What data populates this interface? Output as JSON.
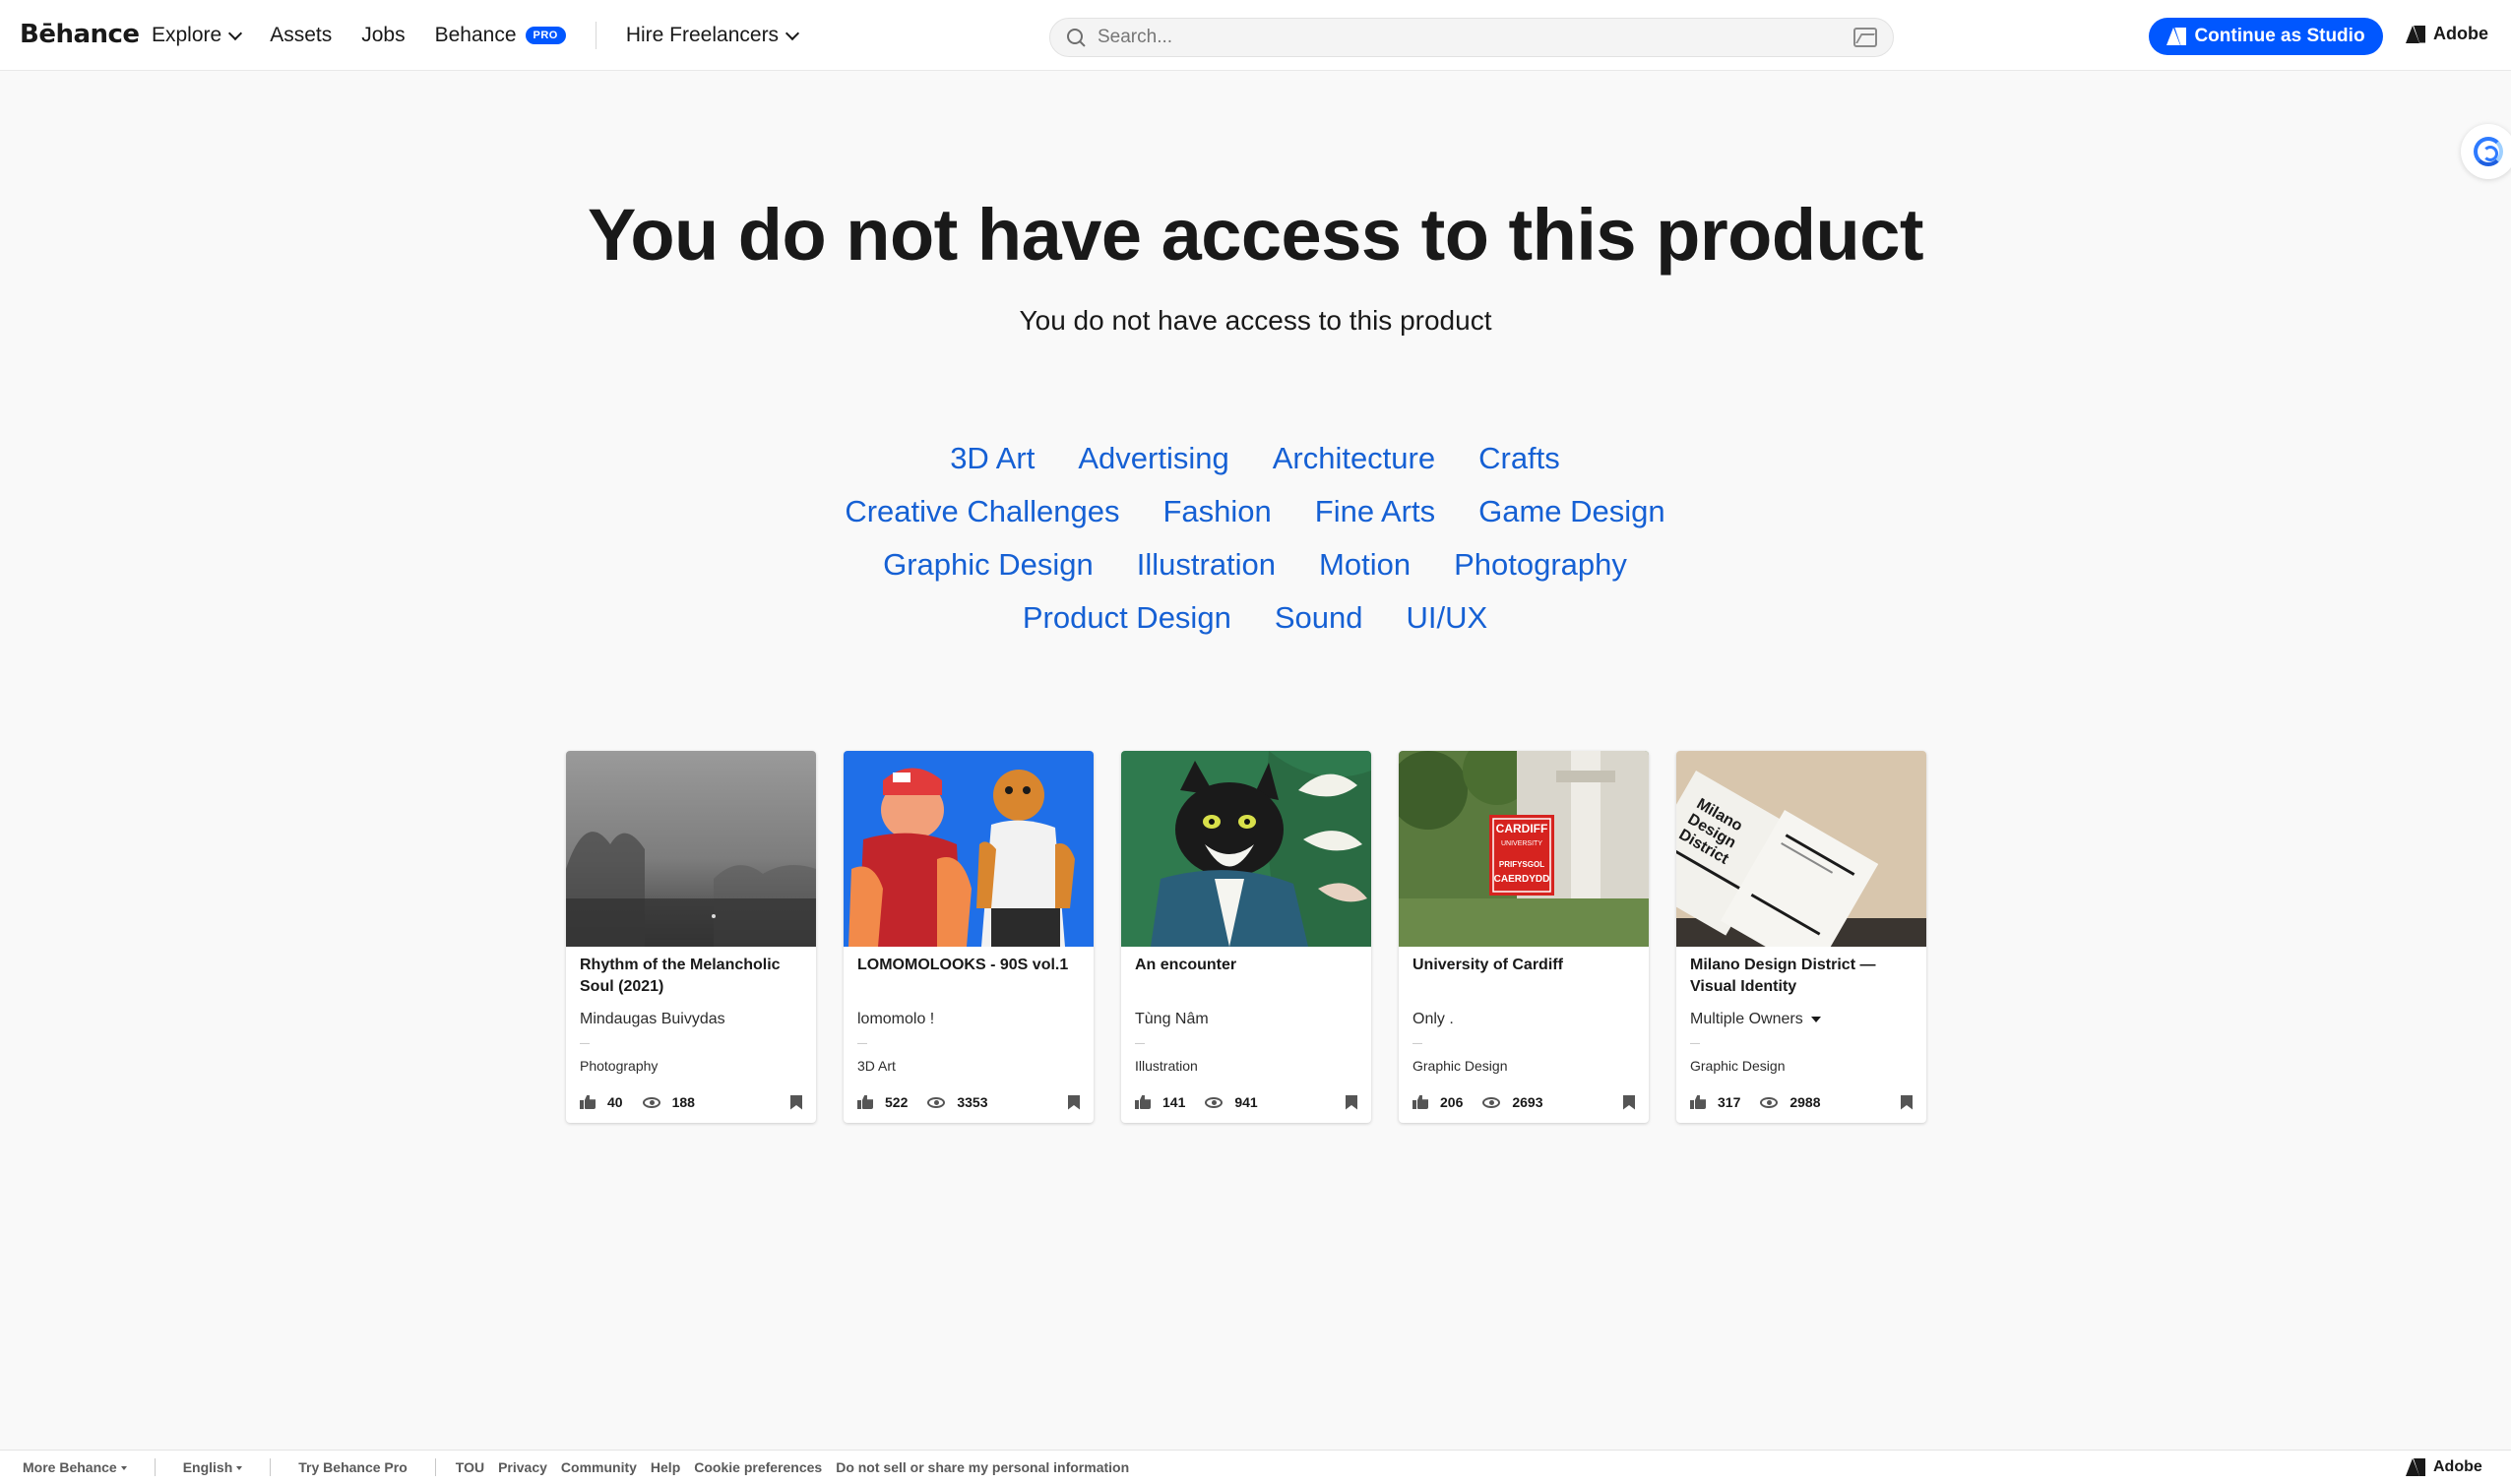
{
  "nav": {
    "logo": "Bēhance",
    "links": {
      "explore": "Explore",
      "assets": "Assets",
      "jobs": "Jobs",
      "behance": "Behance",
      "pro_badge": "PRO",
      "hire": "Hire Freelancers"
    },
    "search_placeholder": "Search...",
    "cta": "Continue as Studio",
    "adobe": "Adobe",
    "colors": {
      "accent": "#0057ff"
    }
  },
  "main": {
    "headline": "You do not have access to this product",
    "subline": "You do not have access to this product",
    "categories": [
      [
        "3D Art",
        "Advertising",
        "Architecture",
        "Crafts"
      ],
      [
        "Creative Challenges",
        "Fashion",
        "Fine Arts",
        "Game Design"
      ],
      [
        "Graphic Design",
        "Illustration",
        "Motion",
        "Photography"
      ],
      [
        "Product Design",
        "Sound",
        "UI/UX"
      ]
    ],
    "link_color": "#1560d4"
  },
  "cards": [
    {
      "title": "Rhythm of the Melancholic Soul (2021)",
      "owner": "Mindaugas Buivydas",
      "multi": false,
      "sep": "—",
      "field": "Photography",
      "likes": "40",
      "views": "188"
    },
    {
      "title": "LOMOMOLOOKS - 90S vol.1",
      "owner": "lomomolo !",
      "multi": false,
      "sep": "—",
      "field": "3D Art",
      "likes": "522",
      "views": "3353"
    },
    {
      "title": "An encounter",
      "owner": "Tùng Nâm",
      "multi": false,
      "sep": "—",
      "field": "Illustration",
      "likes": "141",
      "views": "941"
    },
    {
      "title": "University of Cardiff",
      "owner": "Only .",
      "multi": false,
      "sep": "—",
      "field": "Graphic Design",
      "likes": "206",
      "views": "2693"
    },
    {
      "title": "Milano Design District — Visual Identity",
      "owner": "Multiple Owners",
      "multi": true,
      "sep": "—",
      "field": "Graphic Design",
      "likes": "317",
      "views": "2988"
    }
  ],
  "cardart": {
    "cardiff_sign": [
      "CARDIFF",
      "UNIVERSITY",
      "PRIFYSGOL",
      "CAERDYDD"
    ],
    "milano_sign": [
      "Milano",
      "Design",
      "District"
    ]
  },
  "footer": {
    "more": "More Behance",
    "lang": "English",
    "try_pro": "Try Behance Pro",
    "tou": "TOU",
    "privacy": "Privacy",
    "community": "Community",
    "help": "Help",
    "cookie": "Cookie preferences",
    "do_not_sell": "Do not sell or share my personal information",
    "adobe": "Adobe"
  }
}
